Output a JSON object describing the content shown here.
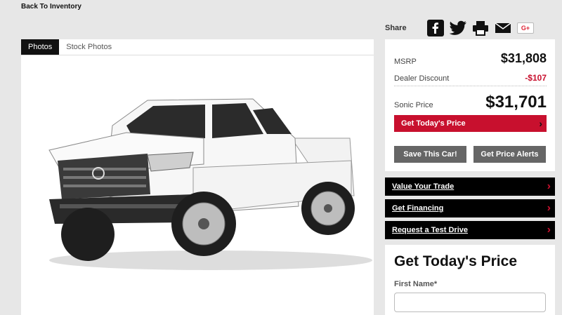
{
  "nav": {
    "back_label": "Back To Inventory"
  },
  "gallery": {
    "tabs": [
      {
        "label": "Photos",
        "active": true
      },
      {
        "label": "Stock Photos",
        "active": false
      }
    ]
  },
  "share": {
    "label": "Share",
    "icons": [
      "facebook-icon",
      "twitter-icon",
      "print-icon",
      "email-icon",
      "google-plus-icon"
    ],
    "gplus_text": "G+"
  },
  "pricing": {
    "msrp_label": "MSRP",
    "msrp_value": "$31,808",
    "discount_label": "Dealer Discount",
    "discount_value": "-$107",
    "sonic_label": "Sonic Price",
    "sonic_value": "$31,701",
    "cta_label": "Get Today's Price",
    "save_label": "Save This Car!",
    "alerts_label": "Get Price Alerts"
  },
  "actions": [
    {
      "label": "Value Your Trade"
    },
    {
      "label": "Get Financing"
    },
    {
      "label": "Request a Test Drive"
    }
  ],
  "form": {
    "title": "Get Today's Price",
    "first_name_label": "First Name",
    "required_mark": "*",
    "first_name_value": ""
  },
  "colors": {
    "accent": "#c8102e",
    "dark": "#000000",
    "gray_button": "#666666",
    "page_bg": "#e7e7e7"
  }
}
